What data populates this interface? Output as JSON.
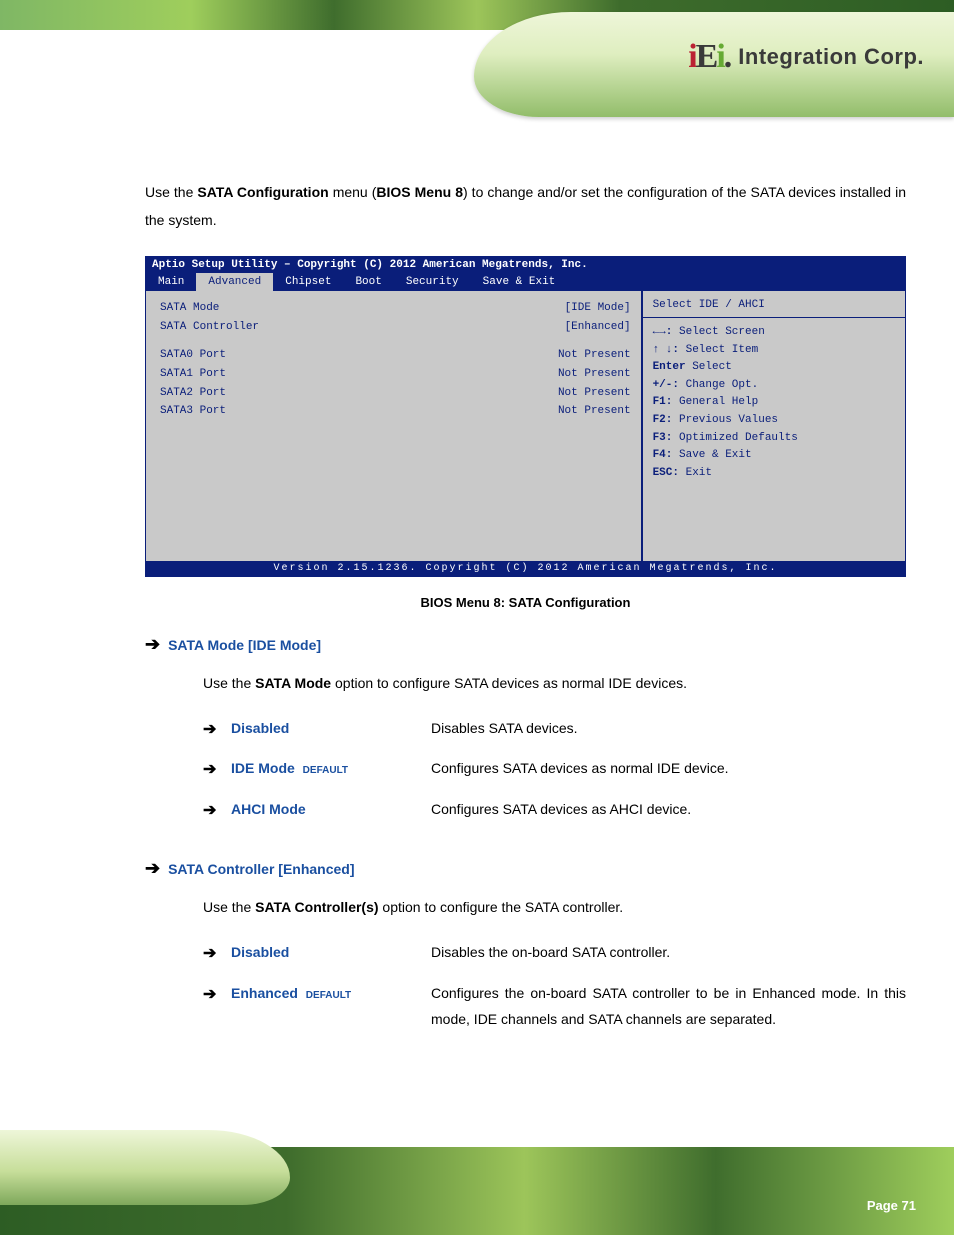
{
  "header": {
    "logo_text": "Integration Corp."
  },
  "intro": {
    "pre": "Use the ",
    "menu_bold": "SATA Configuration",
    "mid": " menu (",
    "ref_bold": "BIOS Menu 8",
    "post": ") to change and/or set the configuration of the SATA devices installed in the system."
  },
  "bios": {
    "title": "Aptio Setup Utility – Copyright (C) 2012 American Megatrends, Inc.",
    "tabs": [
      "Main",
      "Advanced",
      "Chipset",
      "Boot",
      "Security",
      "Save & Exit"
    ],
    "active_tab": 1,
    "rows": [
      {
        "label": "SATA Mode",
        "value": "[IDE Mode]"
      },
      {
        "label": "SATA Controller",
        "value": "[Enhanced]"
      },
      {
        "label": "SATA0 Port",
        "value": "Not Present"
      },
      {
        "label": "SATA1 Port",
        "value": "Not Present"
      },
      {
        "label": "SATA2 Port",
        "value": "Not Present"
      },
      {
        "label": "SATA3 Port",
        "value": "Not Present"
      }
    ],
    "right_desc": "Select IDE / AHCI",
    "help": [
      {
        "k": "←→:",
        "t": "Select Screen"
      },
      {
        "k": "↑ ↓:",
        "t": "Select Item"
      },
      {
        "k": "Enter",
        "t": "Select"
      },
      {
        "k": "+/-:",
        "t": "Change Opt."
      },
      {
        "k": "F1:",
        "t": "General Help"
      },
      {
        "k": "F2:",
        "t": "Previous Values"
      },
      {
        "k": "F3:",
        "t": "Optimized Defaults"
      },
      {
        "k": "F4:",
        "t": "Save & Exit"
      },
      {
        "k": "ESC:",
        "t": "Exit"
      }
    ],
    "footer": "Version 2.15.1236. Copyright (C) 2012 American Megatrends, Inc."
  },
  "caption": "BIOS Menu 8: SATA Configuration",
  "param1": {
    "head": "SATA Mode [IDE Mode]",
    "body_pre": "Use the ",
    "body_bold": "SATA Mode",
    "body_post": " option to configure SATA devices as normal IDE devices.",
    "opts": [
      {
        "label": "Disabled",
        "def": "",
        "desc": "Disables SATA devices."
      },
      {
        "label": "IDE Mode",
        "def": "DEFAULT",
        "desc": "Configures SATA devices as normal IDE device."
      },
      {
        "label": "AHCI Mode",
        "def": "",
        "desc": "Configures SATA devices as AHCI device."
      }
    ]
  },
  "param2": {
    "head": "SATA Controller [Enhanced]",
    "body_pre": "Use the ",
    "body_bold": "SATA Controller(s)",
    "body_post": " option to configure the SATA controller.",
    "opts": [
      {
        "label": "Disabled",
        "def": "",
        "desc": "Disables the on-board SATA controller."
      },
      {
        "label": "Enhanced",
        "def": "DEFAULT",
        "desc": "Configures the on-board SATA controller to be in Enhanced mode. In this mode, IDE channels and SATA channels are separated."
      }
    ]
  },
  "page_number": "Page 71"
}
